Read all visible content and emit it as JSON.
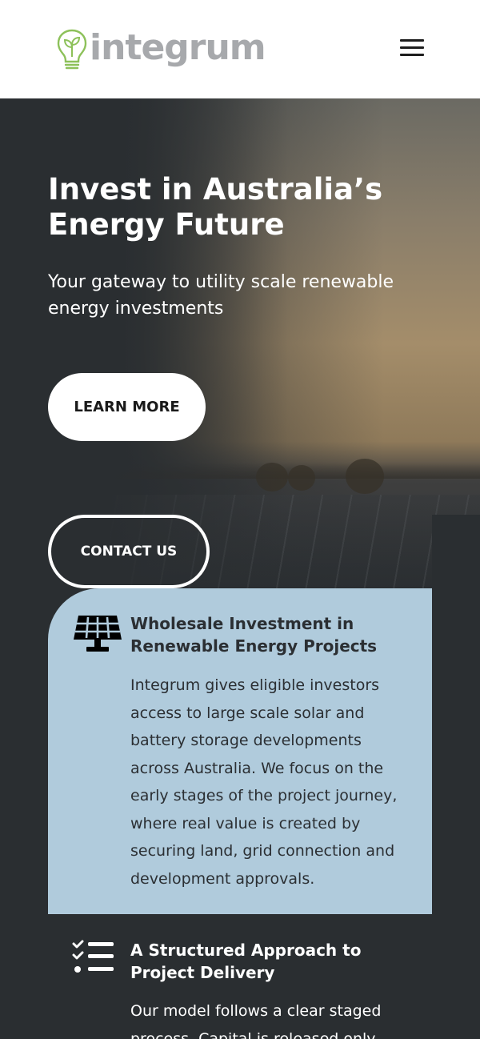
{
  "header": {
    "logo_text": "integrum",
    "logo_icon": "lightbulb-leaf-icon",
    "menu_icon": "hamburger-menu-icon"
  },
  "hero": {
    "title": "Invest in Australia’s Energy Future",
    "subtitle": "Your gateway to utility scale renewable energy investments",
    "learn_more_label": "LEARN MORE",
    "contact_label": "CONTACT US"
  },
  "features": [
    {
      "icon": "solar-panel-icon",
      "title": "Wholesale Investment in Renewable Energy Projects",
      "body": "Integrum gives eligible investors access to large scale solar and battery storage developments across Australia. We focus on the early stages of the project journey, where real value is created by securing land, grid connection and development approvals."
    },
    {
      "icon": "checklist-icon",
      "title": "A Structured Approach to Project Delivery",
      "body": "Our model follows a clear staged process. Capital is released only"
    }
  ],
  "colors": {
    "logo_green": "#8dc15a",
    "logo_gray": "#a7a9ac",
    "page_dark": "#2a2e31",
    "card_blue": "#b0cbdc"
  }
}
